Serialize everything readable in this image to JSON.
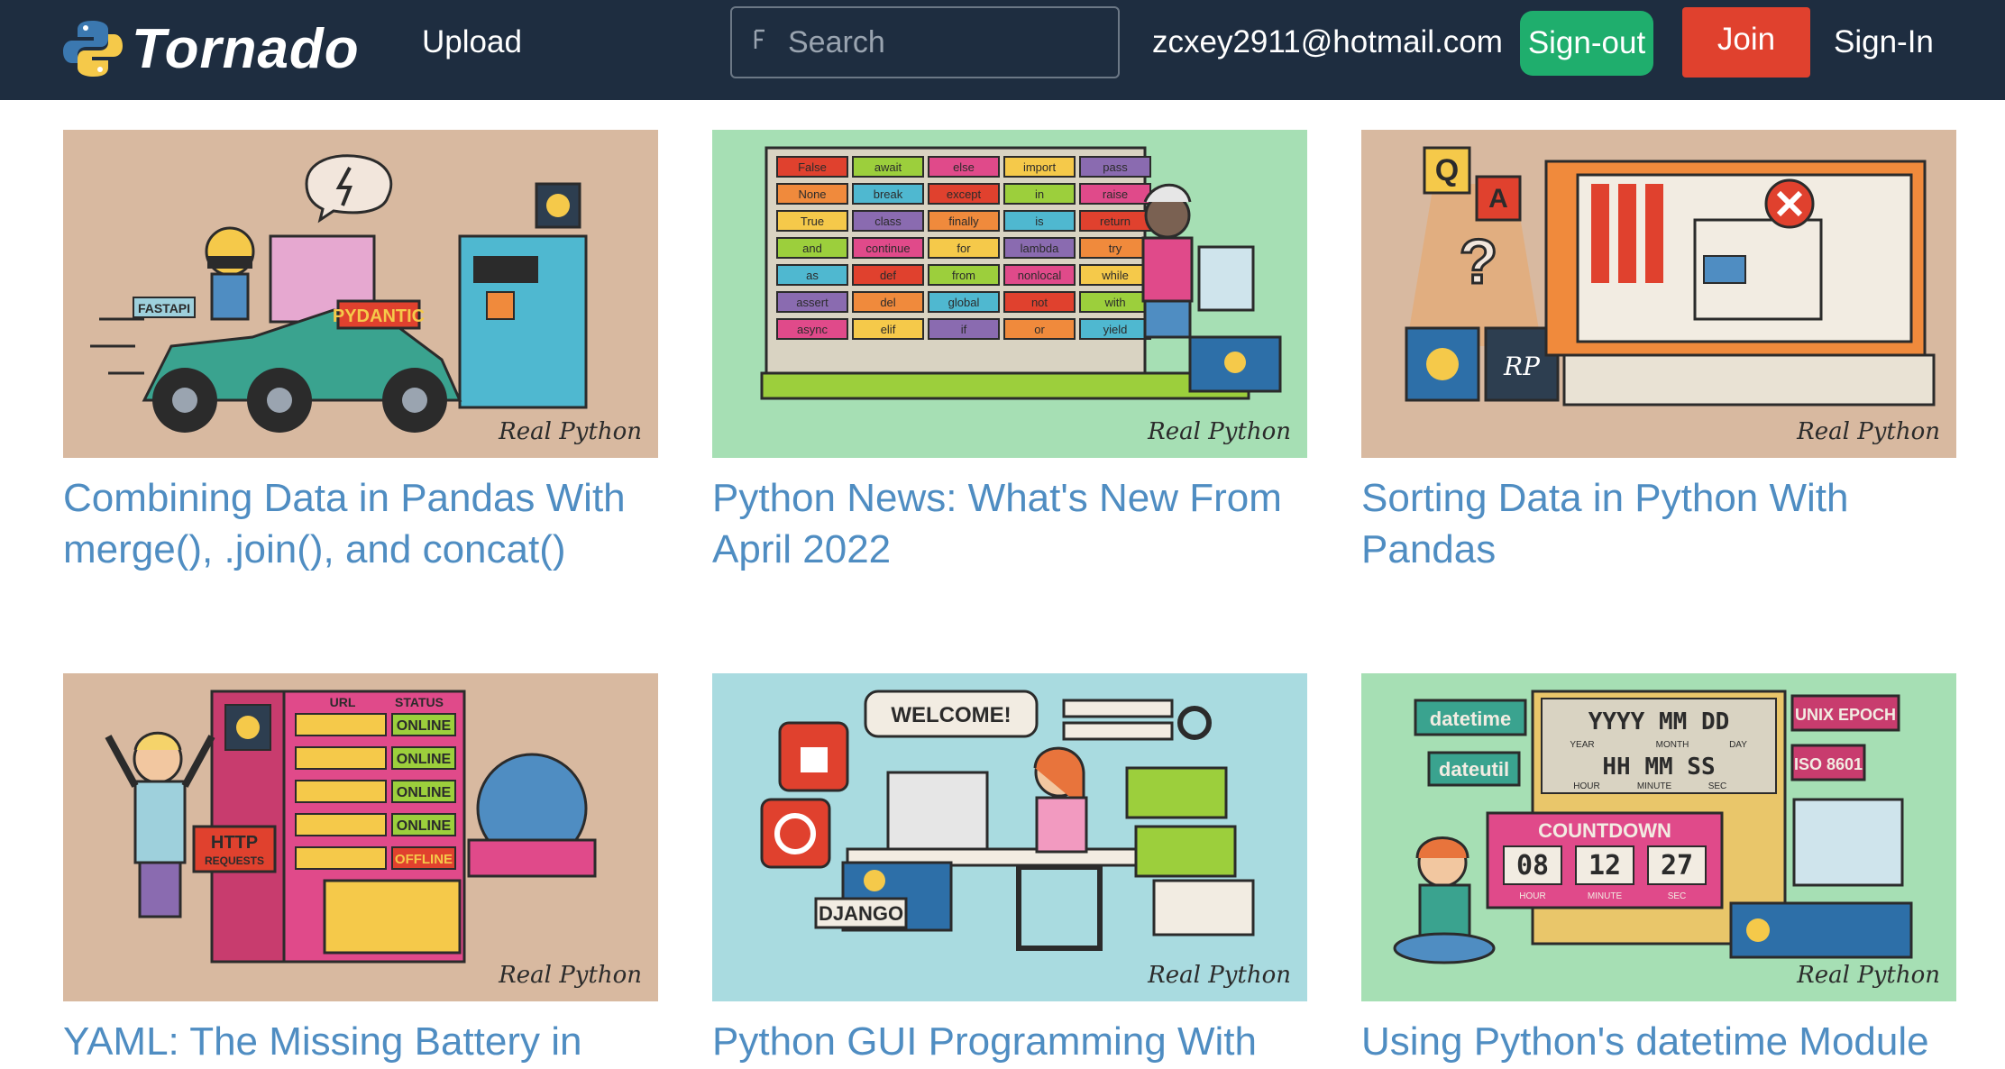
{
  "brand": {
    "name": "Tornado"
  },
  "nav": {
    "upload_label": "Upload",
    "search_placeholder": "Search",
    "user_email": "zcxey2911@hotmail.com",
    "signout_label": "Sign-out",
    "join_label": "Join",
    "signin_label": "Sign-In"
  },
  "colors": {
    "navbar": "#1e2d40",
    "signout": "#1fae6d",
    "join": "#e0412e",
    "title_link": "#4f8dc2"
  },
  "articles": [
    {
      "title": "Combining Data in Pandas With merge(), .join(), and concat()",
      "thumb_bg": "#d8b9a0",
      "labels": [
        "FASTAPI",
        "PYDANTIC"
      ],
      "watermark": "Real Python"
    },
    {
      "title": "Python News: What's New From April 2022",
      "thumb_bg": "#a6dfb4",
      "labels": [
        "False",
        "await",
        "else",
        "import",
        "pass",
        "None",
        "break",
        "except",
        "in",
        "raise",
        "True",
        "class",
        "finally",
        "is",
        "return",
        "and",
        "continue",
        "for",
        "lambda",
        "try",
        "as",
        "def",
        "from",
        "nonlocal",
        "while",
        "assert",
        "del",
        "global",
        "not",
        "with",
        "async",
        "elif",
        "if",
        "or",
        "yield"
      ],
      "watermark": "Real Python"
    },
    {
      "title": "Sorting Data in Python With Pandas",
      "thumb_bg": "#d8b9a0",
      "labels": [
        "Q",
        "A",
        "?",
        "RP"
      ],
      "watermark": "Real Python"
    },
    {
      "title": "YAML: The Missing Battery in",
      "thumb_bg": "#d8b9a0",
      "labels": [
        "URL",
        "STATUS",
        "ONLINE",
        "ONLINE",
        "ONLINE",
        "ONLINE",
        "OFFLINE",
        "HTTP",
        "REQUESTS"
      ],
      "watermark": "Real Python"
    },
    {
      "title": "Python GUI Programming With",
      "thumb_bg": "#a9dbe0",
      "labels": [
        "WELCOME!",
        "DJANGO"
      ],
      "watermark": "Real Python"
    },
    {
      "title": "Using Python's datetime Module",
      "thumb_bg": "#a6dfb4",
      "labels": [
        "datetime",
        "dateutil",
        "Y",
        "Y",
        "Y",
        "Y",
        "M",
        "M",
        "D",
        "D",
        "YEAR",
        "MONTH",
        "DAY",
        "H",
        "H",
        "M",
        "M",
        "S",
        "S",
        "HOUR",
        "MINUTE",
        "SEC",
        "UNIX EPOCH",
        "ISO 8601",
        "COUNTDOWN",
        "08",
        "12",
        "27",
        "HOUR",
        "MINUTE",
        "SEC"
      ],
      "watermark": "Real Python"
    }
  ]
}
